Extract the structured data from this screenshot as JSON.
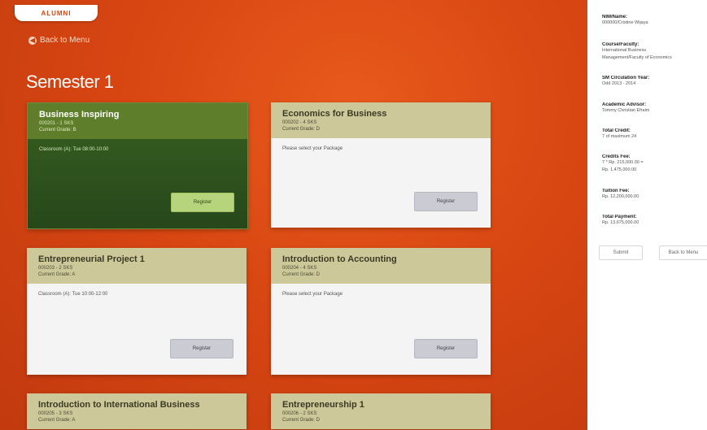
{
  "header": {
    "logo_text": "ALUMNI",
    "back_label": "Back to Menu"
  },
  "semester_title": "Semester 1",
  "courses": [
    {
      "name": "Business Inspiring",
      "code": "000201 - 1 SKS",
      "grade": "Current Grade: B",
      "note": "Classroom (A): Tue 08:00-10:00",
      "button": "Register",
      "selected": true
    },
    {
      "name": "Economics for Business",
      "code": "000202 - 4 SKS",
      "grade": "Current Grade: D",
      "note": "Please select your Package",
      "button": "Register",
      "selected": false
    },
    {
      "name": "Entrepreneurial Project 1",
      "code": "000203 - 2 SKS",
      "grade": "Current Grade: A",
      "note": "Classroom (A): Tue 10:00-12:00",
      "button": "Register",
      "selected": false
    },
    {
      "name": "Introduction to Accounting",
      "code": "000204 - 4 SKS",
      "grade": "Current Grade: D",
      "note": "Please select your Package",
      "button": "Register",
      "selected": false
    },
    {
      "name": "Introduction to International Business",
      "code": "000205 - 3 SKS",
      "grade": "Current Grade: A",
      "note": "",
      "button": "",
      "selected": false
    },
    {
      "name": "Entrepreneurship 1",
      "code": "000206 - 2 SKS",
      "grade": "Current Grade: D",
      "note": "",
      "button": "",
      "selected": false
    }
  ],
  "side": {
    "nim_label": "NIM/Name:",
    "nim_value": "000000/Cristine Wijaya",
    "course_label": "Course/Faculty:",
    "course_value_1": "International Business",
    "course_value_2": "Management/Faculty of Economics",
    "year_label": "SM Circulation Year:",
    "year_value": "Odd 2013 - 2014",
    "advisor_label": "Academic Advisor:",
    "advisor_value": "Tommy Christian Efraim",
    "credit_label": "Total Credit:",
    "credit_value": "7 of maximum 24",
    "fee_label": "Credits Fee:",
    "fee_value_1": "7 * Rp. 215,000.00 =",
    "fee_value_2": "Rp. 1,475,000.00",
    "tuition_label": "Tuition Fee:",
    "tuition_value": "Rp. 12,200,000.00",
    "total_label": "Total Payment:",
    "total_value": "Rp. 13,675,000.00",
    "submit_label": "Submit",
    "back_menu_label": "Back to Menu"
  }
}
